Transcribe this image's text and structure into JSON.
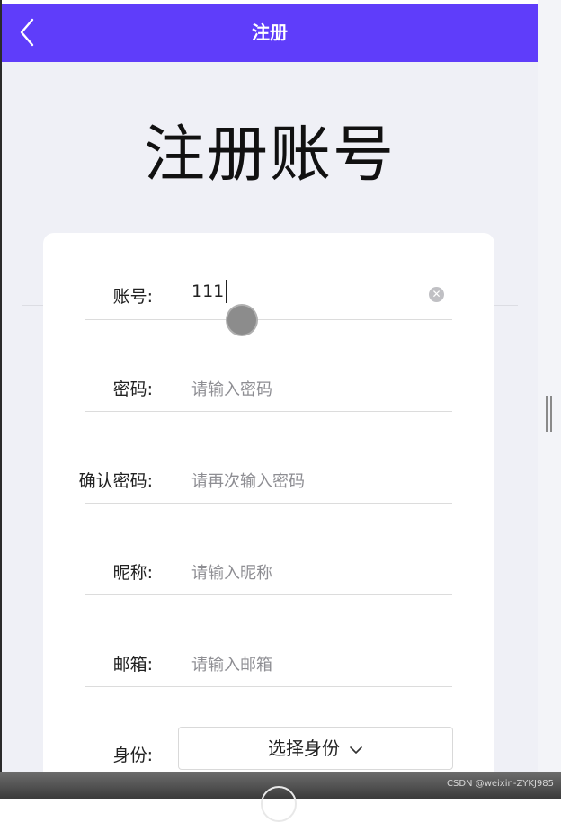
{
  "navbar": {
    "title": "注册",
    "back_icon": "chevron-left-icon",
    "background": "#5f3dfa"
  },
  "heading": "注册账号",
  "form": {
    "account": {
      "label": "账号:",
      "value": "111",
      "clear_icon": "clear-circle-icon"
    },
    "password": {
      "label": "密码:",
      "placeholder": "请输入密码"
    },
    "confirm_password": {
      "label": "确认密码:",
      "placeholder": "请再次输入密码"
    },
    "nickname": {
      "label": "昵称:",
      "placeholder": "请输入昵称"
    },
    "email": {
      "label": "邮箱:",
      "placeholder": "请输入邮箱"
    },
    "identity": {
      "label": "身份:",
      "select_text": "选择身份",
      "dropdown_icon": "chevron-down-icon"
    }
  },
  "watermark": "CSDN @weixin-ZYKJ985"
}
